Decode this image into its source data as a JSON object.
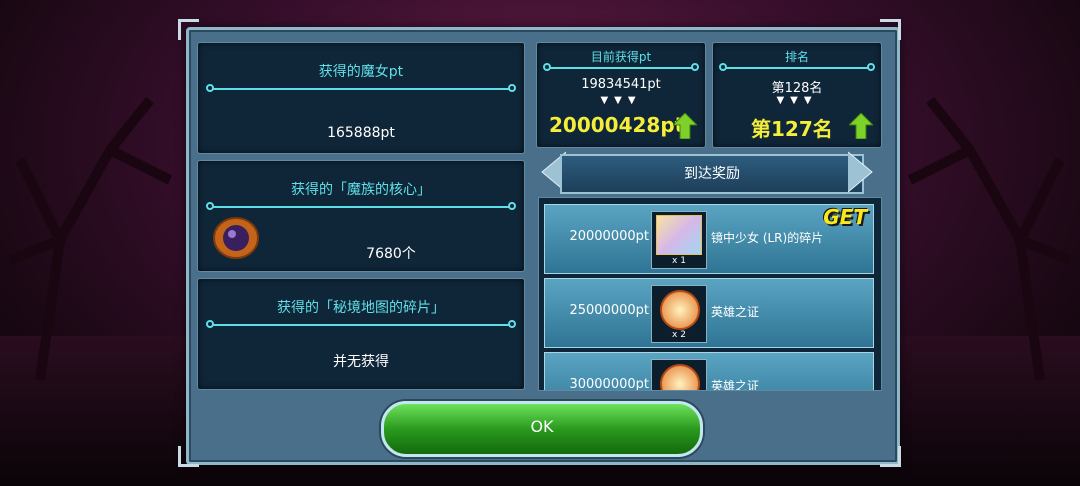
{
  "witch_pt": {
    "title": "获得的魔女pt",
    "value": "165888pt"
  },
  "demon_core": {
    "title": "获得的「魔族的核心」",
    "value": "7680个"
  },
  "map_fragment": {
    "title": "获得的「秘境地图的碎片」",
    "value": "并无获得"
  },
  "current_pt": {
    "title": "目前获得pt",
    "old": "19834541pt",
    "arrows": "▼▼▼",
    "new": "20000428pt"
  },
  "rank": {
    "title": "排名",
    "old": "第128名",
    "arrows": "▼▼▼",
    "new": "第127名"
  },
  "rewards": {
    "header": "到达奖励",
    "items": [
      {
        "pts": "20000000pt",
        "name": "镜中少女 (LR)的碎片",
        "qty": "x 1",
        "badge": "GET"
      },
      {
        "pts": "25000000pt",
        "name": "英雄之证",
        "qty": "x 2"
      },
      {
        "pts": "30000000pt",
        "name": "英雄之证",
        "qty": ""
      }
    ]
  },
  "ok_button": "OK",
  "colors": {
    "accent_cyan": "#5fe0e8",
    "highlight_yellow": "#f4ee3b",
    "ok_green": "#2a9a1e"
  }
}
